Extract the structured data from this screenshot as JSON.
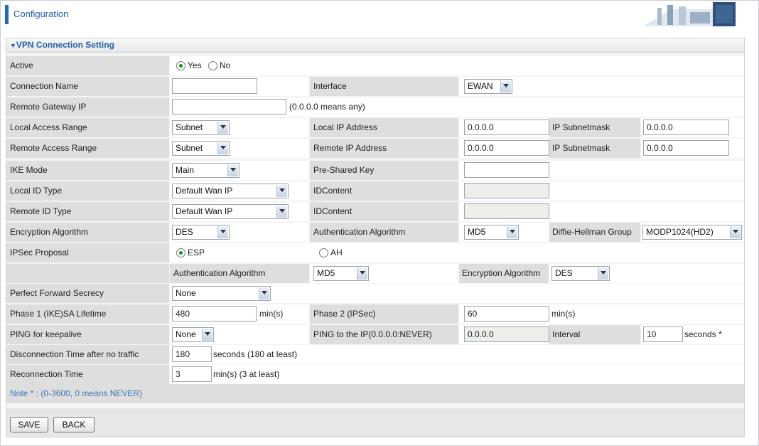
{
  "header": {
    "title": "Configuration"
  },
  "section": {
    "title": "VPN Connection Setting"
  },
  "labels": {
    "active": "Active",
    "connection_name": "Connection Name",
    "interface": "Interface",
    "remote_gateway": "Remote Gateway IP",
    "local_access": "Local Access Range",
    "local_ip": "Local IP Address",
    "ip_subnetmask": "IP Subnetmask",
    "remote_access": "Remote Access Range",
    "remote_ip": "Remote IP Address",
    "ike_mode": "IKE Mode",
    "psk": "Pre-Shared Key",
    "local_id_type": "Local ID Type",
    "idcontent": "IDContent",
    "remote_id_type": "Remote ID Type",
    "enc_alg": "Encryption Algorithm",
    "auth_alg": "Authentication Algorithm",
    "dh_group": "Diffie-Hellman Group",
    "ipsec_proposal": "IPSec Proposal",
    "pfs": "Perfect Forward Secrecy",
    "phase1": "Phase 1 (IKE)SA Lifetime",
    "phase2": "Phase 2 (IPSec)",
    "ping_keepalive": "PING for keepalive",
    "ping_ip": "PING to the IP(0.0.0.0:NEVER)",
    "interval": "Interval",
    "disc_time": "Disconnection Time after no traffic",
    "reconn_time": "Reconnection Time"
  },
  "active": {
    "yes": "Yes",
    "no": "No",
    "selected": "Yes"
  },
  "values": {
    "connection_name": "",
    "interface": "EWAN",
    "remote_gateway": "",
    "remote_gateway_hint": "(0.0.0.0 means any)",
    "local_access": "Subnet",
    "local_ip": "0.0.0.0",
    "local_subnet": "0.0.0.0",
    "remote_access": "Subnet",
    "remote_ip": "0.0.0.0",
    "remote_subnet": "0.0.0.0",
    "ike_mode": "Main",
    "psk": "",
    "local_id_type": "Default Wan IP",
    "local_idcontent": "",
    "remote_id_type": "Default Wan IP",
    "remote_idcontent": "",
    "enc_alg": "DES",
    "auth_alg": "MD5",
    "dh_group": "MODP1024(HD2)",
    "ipsec_esp": "ESP",
    "ipsec_ah": "AH",
    "ipsec_selected": "ESP",
    "ipsec_auth_alg": "MD5",
    "ipsec_enc_alg": "DES",
    "pfs": "None",
    "phase1": "480",
    "phase1_unit": "min(s)",
    "phase2": "60",
    "phase2_unit": "min(s)",
    "ping_keepalive": "None",
    "ping_ip": "0.0.0.0",
    "interval": "10",
    "interval_unit": "seconds *",
    "disc_time": "180",
    "disc_unit": "seconds (180 at least)",
    "reconn_time": "3",
    "reconn_unit": "min(s) (3 at least)"
  },
  "note": "Note * : (0-3600, 0 means NEVER)",
  "buttons": {
    "save": "SAVE",
    "back": "BACK"
  },
  "colors": {
    "accent": "#1f6db3",
    "label_bg": "#dedede",
    "note_text": "#3a76b6"
  }
}
